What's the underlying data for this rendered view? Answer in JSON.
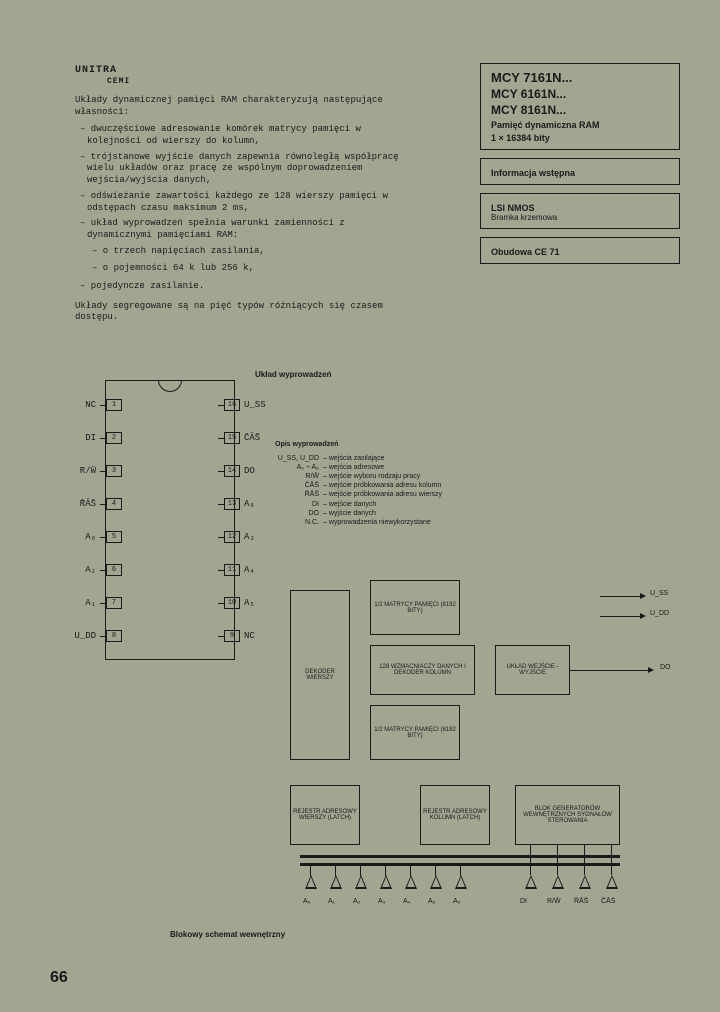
{
  "logo": "UNITRA",
  "logo_sub": "CEMI",
  "intro": {
    "p1": "Układy dynamicznej pamięci RAM charakteryzują następujące własności:",
    "i1": "– dwuczęściowe adresowanie komórek matrycy pamięci w kolejności od wierszy do kolumn,",
    "i2": "– trójstanowe wyjście danych zapewnia równoległą współpracę wielu układów oraz pracę ze wspólnym doprowadzeniem wejścia/wyjścia danych,",
    "i3": "– odświeżanie zawartości każdego ze 128 wierszy pamięci w odstępach czasu maksimum 2 ms,",
    "i4": "– układ wyprowadzeń spełnia warunki zamienności z dynamicznymi pamięciami RAM:",
    "i4a": "– o trzech napięciach zasilania,",
    "i4b": "– o pojemności 64 k lub 256 k,",
    "i5": "– pojedyncze zasilanie.",
    "p2": "Układy segregowane są na pięć typów różniących się czasem dostępu."
  },
  "info": {
    "box1": {
      "l1": "MCY 7161N...",
      "l2": "MCY 6161N...",
      "l3": "MCY 8161N...",
      "l4": "Pamięć dynamiczna RAM",
      "l5": "1 × 16384 bity"
    },
    "box2": "Informacja wstępna",
    "box3": {
      "l1": "LSI NMOS",
      "l2": "Bramka krzemowa"
    },
    "box4": "Obudowa CE 71"
  },
  "pinout_title": "Układ wyprowadzeń",
  "pins_left": [
    {
      "label": "NC",
      "num": "1"
    },
    {
      "label": "DI",
      "num": "2"
    },
    {
      "label": "R/W̄",
      "num": "3"
    },
    {
      "label": "R̄ĀS̄",
      "num": "4"
    },
    {
      "label": "A₀",
      "num": "5"
    },
    {
      "label": "A₂",
      "num": "6"
    },
    {
      "label": "A₁",
      "num": "7"
    },
    {
      "label": "U_DD",
      "num": "8"
    }
  ],
  "pins_right": [
    {
      "label": "U_SS",
      "num": "16"
    },
    {
      "label": "C̄ĀS̄",
      "num": "15"
    },
    {
      "label": "DO",
      "num": "14"
    },
    {
      "label": "A₆",
      "num": "13"
    },
    {
      "label": "A₃",
      "num": "12"
    },
    {
      "label": "A₄",
      "num": "11"
    },
    {
      "label": "A₅",
      "num": "10"
    },
    {
      "label": "NC",
      "num": "9"
    }
  ],
  "pin_desc": {
    "hdr": "Opis wyprowadzeń",
    "rows": [
      {
        "sym": "U_SS, U_DD",
        "txt": "– wejścia zasilające"
      },
      {
        "sym": "A₀ ÷ A₆",
        "txt": "– wejścia adresowe"
      },
      {
        "sym": "R/W̄",
        "txt": "– wejście wyboru rodzaju pracy"
      },
      {
        "sym": "C̄ĀS̄",
        "txt": "– wejście próbkowania adresu kolumn"
      },
      {
        "sym": "R̄ĀS̄",
        "txt": "– wejście próbkowania adresu wierszy"
      },
      {
        "sym": "DI",
        "txt": "– wejście danych"
      },
      {
        "sym": "DO",
        "txt": "– wyjście danych"
      },
      {
        "sym": "N.C.",
        "txt": "– wyprowadzenia niewykorzystane"
      }
    ]
  },
  "blocks": {
    "dec": "DEKODER\nWIERSZY",
    "mat1": "1/2 MATRYCY\nPAMIĘCI\n(8192 BITY)",
    "amp": "128 WZMACNIACZY\nDANYCH I\nDEKODER KOLUMN",
    "mat2": "1/2 MATRYCY\nPAMIĘCI\n(8192 BITY)",
    "io": "UKŁAD\nWEJŚCIE\n- WYJŚCIE",
    "regw": "REJESTR\nADRESOWY\nWIERSZY\n(LATCH)",
    "regk": "REJESTR\nADRESOWY\nKOLUMN\n(LATCH)",
    "gen": "BLOK GENERATORÓW\nWEWNĘTRZNYCH\nSYGNAŁÓW\nSTEROWANIA"
  },
  "signals": {
    "uss": "U_SS",
    "udd": "U_DD",
    "do": "DO",
    "addr": [
      "A₀",
      "A₁",
      "A₂",
      "A₃",
      "A₄",
      "A₅",
      "A₆"
    ],
    "ctrl": [
      "DI",
      "R/W̄",
      "R̄ĀS̄",
      "C̄ĀS̄"
    ]
  },
  "bd_label": "Blokowy schemat wewnętrzny",
  "page_num": "66"
}
